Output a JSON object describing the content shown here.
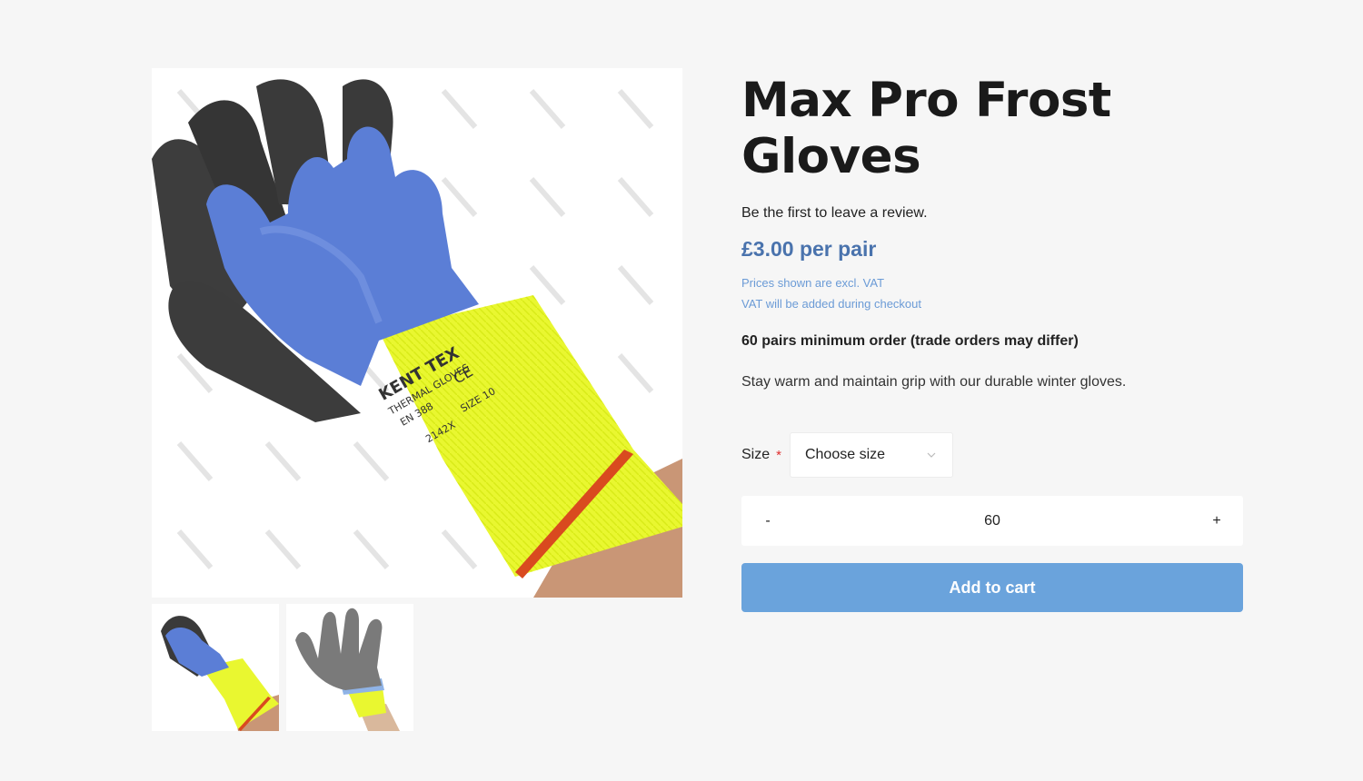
{
  "product": {
    "title": "Max Pro Frost Gloves",
    "review_prompt": "Be the first to leave a review.",
    "price": "£3.00 per pair",
    "vat_note_1": "Prices shown are excl. VAT",
    "vat_note_2": "VAT will be added during checkout",
    "min_order": "60 pairs minimum order (trade orders may differ)",
    "description": "Stay warm and maintain grip with our durable winter gloves."
  },
  "options": {
    "size_label": "Size",
    "required_mark": "*",
    "size_selected": "Choose size"
  },
  "quantity": {
    "minus": "-",
    "value": "60",
    "plus": "+"
  },
  "cart": {
    "add_label": "Add to cart"
  },
  "gallery": {
    "main_image": "blue-yellow-thermal-glove-photo",
    "thumbnails": [
      "blue-yellow-thermal-glove-back",
      "grey-palm-glove-front"
    ],
    "glove_print": [
      "KENT TEX",
      "THERMAL GLOVES",
      "EN 388",
      "CE",
      "SIZE 10",
      "2142X"
    ]
  },
  "colors": {
    "accent": "#6aa3dc",
    "price": "#4a73ad",
    "vat_text": "#6b9bd6",
    "required": "#e03030",
    "background": "#f6f6f6"
  }
}
